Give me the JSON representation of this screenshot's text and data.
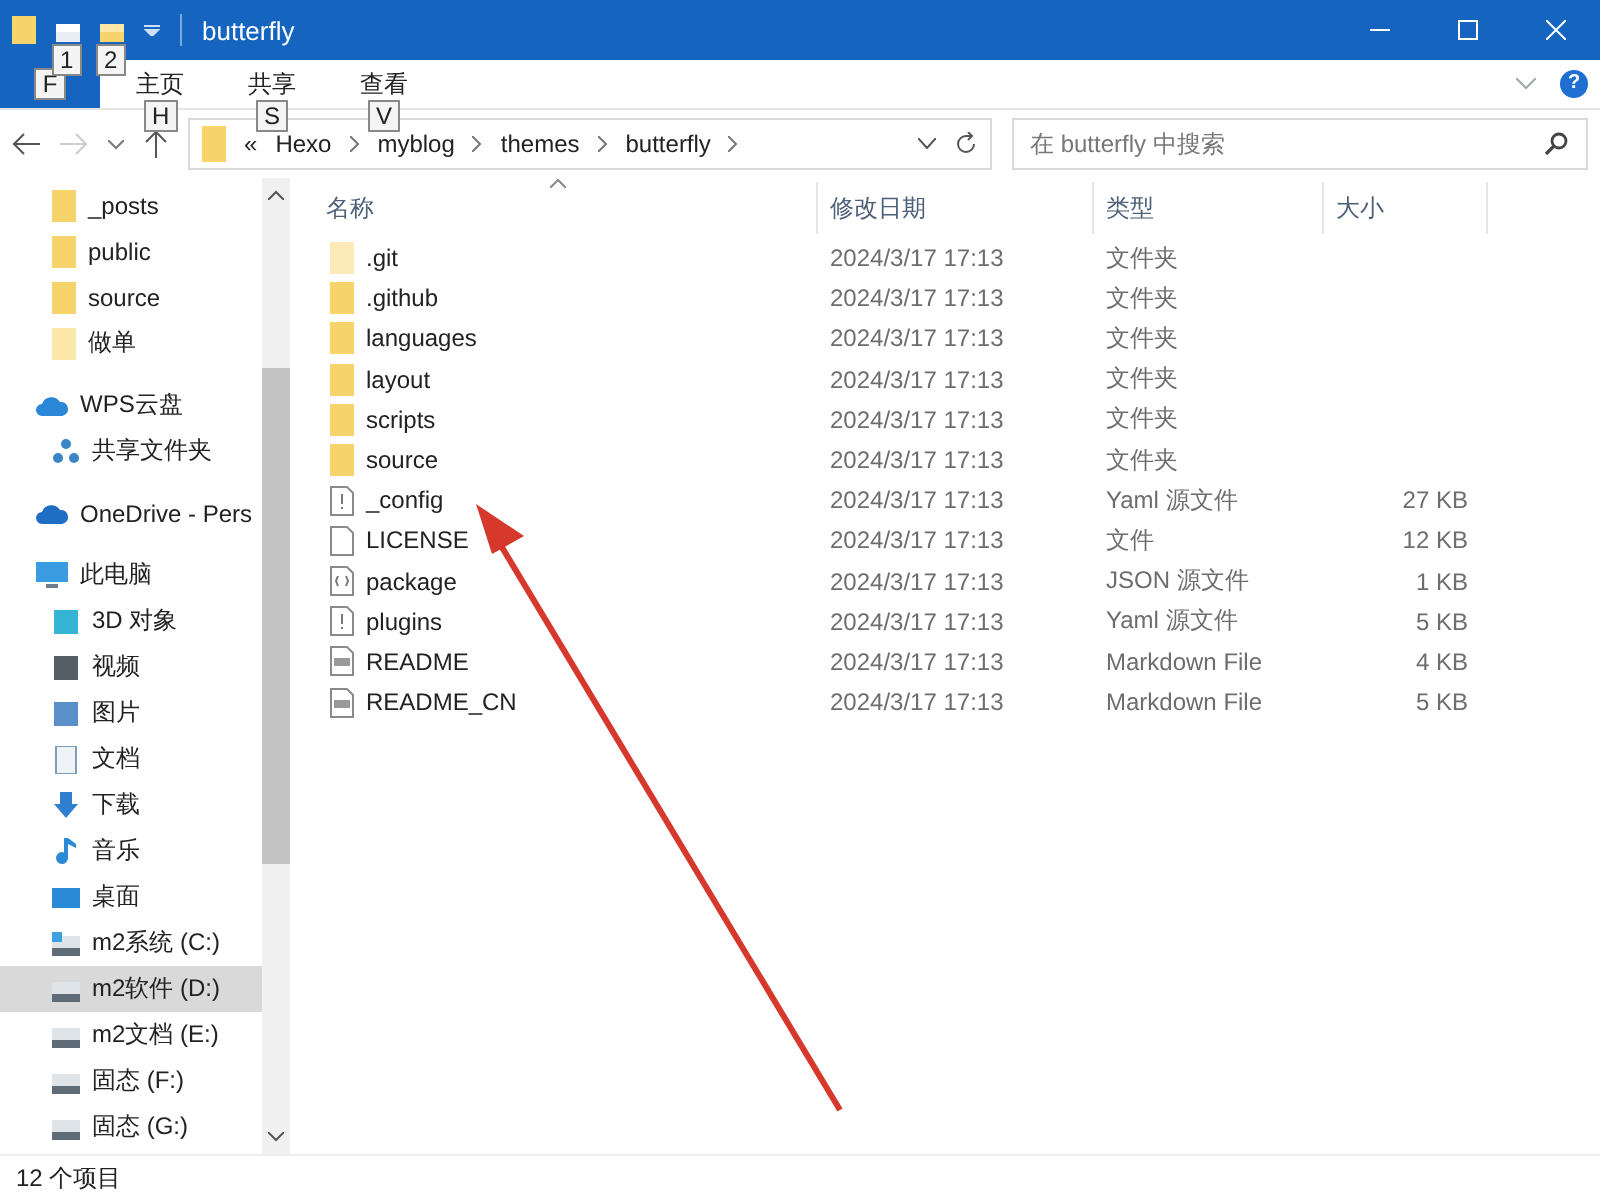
{
  "title_bar": {
    "title": "butterfly",
    "quick_access_keytips": [
      "1",
      "2"
    ]
  },
  "ribbon": {
    "file_keytip": "F",
    "tabs": [
      {
        "label": "主页",
        "keytip": "H"
      },
      {
        "label": "共享",
        "keytip": "S"
      },
      {
        "label": "查看",
        "keytip": "V"
      }
    ],
    "help": "?"
  },
  "address": {
    "overflow": "«",
    "path": [
      "Hexo",
      "myblog",
      "themes",
      "butterfly"
    ],
    "search_placeholder": "在 butterfly 中搜索"
  },
  "sidebar": {
    "partial_group": [
      {
        "label": "_posts",
        "kind": "folder",
        "selected": false
      },
      {
        "label": "public",
        "kind": "folder",
        "selected": false
      },
      {
        "label": "source",
        "kind": "folder",
        "selected": false
      },
      {
        "label": "做单",
        "kind": "pale-folder",
        "selected": false
      }
    ],
    "items": [
      {
        "label": "WPS云盘",
        "kind": "cloud",
        "selected": false,
        "children": [
          {
            "label": "共享文件夹",
            "kind": "share",
            "selected": false
          }
        ]
      },
      {
        "label": "OneDrive - Pers",
        "kind": "onedrive",
        "selected": false
      },
      {
        "label": "此电脑",
        "kind": "pc",
        "selected": false,
        "children": [
          {
            "label": "3D 对象",
            "kind": "cube",
            "selected": false
          },
          {
            "label": "视频",
            "kind": "video",
            "selected": false
          },
          {
            "label": "图片",
            "kind": "picture",
            "selected": false
          },
          {
            "label": "文档",
            "kind": "document",
            "selected": false
          },
          {
            "label": "下载",
            "kind": "download",
            "selected": false
          },
          {
            "label": "音乐",
            "kind": "music",
            "selected": false
          },
          {
            "label": "桌面",
            "kind": "desktop",
            "selected": false
          },
          {
            "label": "m2系统 (C:)",
            "kind": "system-drive",
            "selected": false
          },
          {
            "label": "m2软件 (D:)",
            "kind": "drive",
            "selected": true
          },
          {
            "label": "m2文档 (E:)",
            "kind": "drive",
            "selected": false
          },
          {
            "label": "固态 (F:)",
            "kind": "drive",
            "selected": false
          },
          {
            "label": "固态 (G:)",
            "kind": "drive",
            "selected": false
          }
        ]
      }
    ]
  },
  "table": {
    "columns": [
      "名称",
      "修改日期",
      "类型",
      "大小"
    ],
    "rows": [
      {
        "kind": "hidden-folder",
        "name": ".git",
        "date": "2024/3/17 17:13",
        "type": "文件夹",
        "size": ""
      },
      {
        "kind": "folder",
        "name": ".github",
        "date": "2024/3/17 17:13",
        "type": "文件夹",
        "size": ""
      },
      {
        "kind": "folder",
        "name": "languages",
        "date": "2024/3/17 17:13",
        "type": "文件夹",
        "size": ""
      },
      {
        "kind": "folder",
        "name": "layout",
        "date": "2024/3/17 17:13",
        "type": "文件夹",
        "size": ""
      },
      {
        "kind": "folder",
        "name": "scripts",
        "date": "2024/3/17 17:13",
        "type": "文件夹",
        "size": ""
      },
      {
        "kind": "folder",
        "name": "source",
        "date": "2024/3/17 17:13",
        "type": "文件夹",
        "size": ""
      },
      {
        "kind": "yaml-file",
        "name": "_config",
        "date": "2024/3/17 17:13",
        "type": "Yaml 源文件",
        "size": "27 KB"
      },
      {
        "kind": "blank-file",
        "name": "LICENSE",
        "date": "2024/3/17 17:13",
        "type": "文件",
        "size": "12 KB"
      },
      {
        "kind": "json-file",
        "name": "package",
        "date": "2024/3/17 17:13",
        "type": "JSON 源文件",
        "size": "1 KB"
      },
      {
        "kind": "yaml-file",
        "name": "plugins",
        "date": "2024/3/17 17:13",
        "type": "Yaml 源文件",
        "size": "5 KB"
      },
      {
        "kind": "markdown-file",
        "name": "README",
        "date": "2024/3/17 17:13",
        "type": "Markdown File",
        "size": "4 KB"
      },
      {
        "kind": "markdown-file",
        "name": "README_CN",
        "date": "2024/3/17 17:13",
        "type": "Markdown File",
        "size": "5 KB"
      }
    ]
  },
  "status_bar": {
    "count": "12 个项目"
  }
}
